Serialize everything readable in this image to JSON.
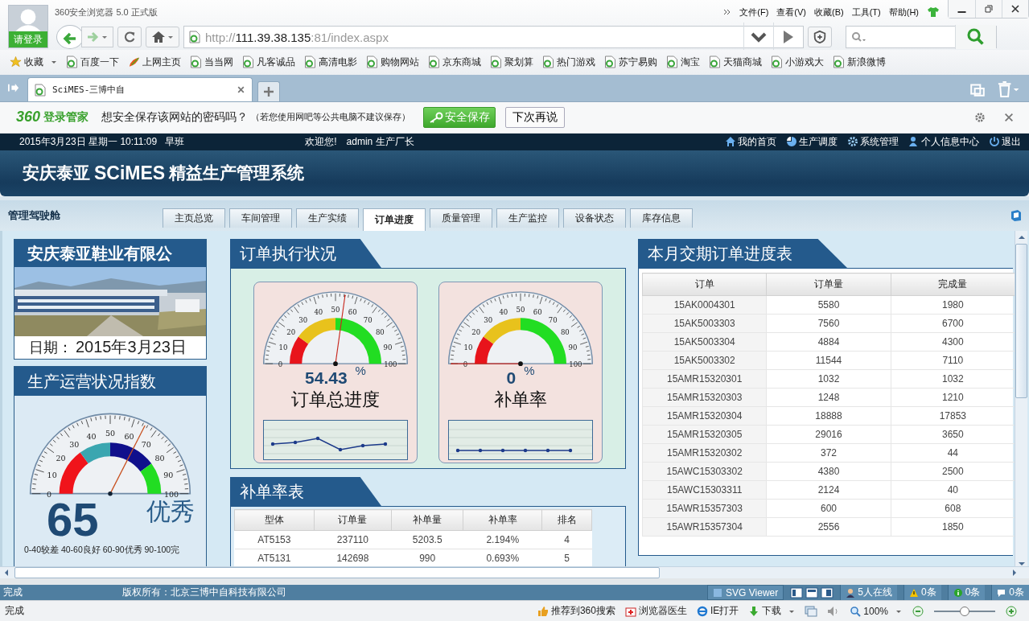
{
  "browser": {
    "title": "360安全浏览器 5.0 正式版",
    "login": "请登录",
    "menu": [
      "文件(F)",
      "查看(V)",
      "收藏(B)",
      "工具(T)",
      "帮助(H)"
    ],
    "address": {
      "scheme": "http://",
      "host": "111.39.38.135",
      "rest": ":81/index.aspx"
    },
    "bookmarks": [
      {
        "label": "收藏",
        "kind": "favorites"
      },
      {
        "label": "百度一下",
        "kind": "page"
      },
      {
        "label": "上网主页",
        "kind": "hao"
      },
      {
        "label": "当当网",
        "kind": "page"
      },
      {
        "label": "凡客诚品",
        "kind": "page"
      },
      {
        "label": "高清电影",
        "kind": "page"
      },
      {
        "label": "购物网站",
        "kind": "page"
      },
      {
        "label": "京东商城",
        "kind": "page"
      },
      {
        "label": "聚划算",
        "kind": "page"
      },
      {
        "label": "热门游戏",
        "kind": "page"
      },
      {
        "label": "苏宁易购",
        "kind": "page"
      },
      {
        "label": "淘宝",
        "kind": "page"
      },
      {
        "label": "天猫商城",
        "kind": "page"
      },
      {
        "label": "小游戏大",
        "kind": "page"
      },
      {
        "label": "新浪微博",
        "kind": "page"
      }
    ],
    "tabs": [
      {
        "label": "SciMES-三博中自",
        "selected": true
      }
    ],
    "password_bar": {
      "brand": "360",
      "product": "登录管家",
      "question": "想安全保存该网站的密码吗？",
      "note": "（若您使用网吧等公共电脑不建议保存）",
      "save": "安全保存",
      "later": "下次再说"
    }
  },
  "top_bar": {
    "datetime": "2015年3月23日  星期一  10:11:09",
    "shift": "早班",
    "welcome": "欢迎您!",
    "user": "admin 生产厂长",
    "links": [
      {
        "label": "我的首页",
        "kind": "home"
      },
      {
        "label": "生产调度",
        "kind": "dispatch"
      },
      {
        "label": "系统管理",
        "kind": "settings"
      },
      {
        "label": "个人信息中心",
        "kind": "user"
      },
      {
        "label": "退出",
        "kind": "logout"
      }
    ]
  },
  "header": {
    "company": "安庆泰亚",
    "brand": "SCiMES",
    "system": "精益生产管理系统"
  },
  "nav": {
    "title": "管理驾驶舱",
    "tabs": [
      {
        "label": "主页总览",
        "selected": false
      },
      {
        "label": "车间管理",
        "selected": false
      },
      {
        "label": "生产实绩",
        "selected": false
      },
      {
        "label": "订单进度",
        "selected": true
      },
      {
        "label": "质量管理",
        "selected": false
      },
      {
        "label": "生产监控",
        "selected": false
      },
      {
        "label": "设备状态",
        "selected": false
      },
      {
        "label": "库存信息",
        "selected": false
      }
    ]
  },
  "company_panel": {
    "title": "安庆泰亚鞋业有限公",
    "date_label": "日期：",
    "date": "2015年3月23日"
  },
  "index_panel": {
    "title": "生产运营状况指数",
    "gauge": {
      "kind": "index",
      "level": 0.65,
      "ticks": [
        "0",
        "10",
        "20",
        "30",
        "40",
        "50",
        "60",
        "70",
        "80",
        "90",
        "100"
      ]
    },
    "value": "65",
    "rating": "优秀",
    "legend": "0-40较差  40-60良好  60-90优秀  90-100完"
  },
  "order_panel": {
    "title": "订单执行状况",
    "gauges": [
      {
        "kind": "progress",
        "level": 0.5443,
        "ticks": [
          "0",
          "10",
          "20",
          "30",
          "40",
          "50",
          "60",
          "70",
          "80",
          "90",
          "100"
        ],
        "value": "54.43",
        "unit": "%",
        "label": "订单总进度"
      },
      {
        "kind": "progress",
        "level": 0,
        "ticks": [
          "0",
          "10",
          "20",
          "30",
          "40",
          "50",
          "60",
          "70",
          "80",
          "90",
          "100"
        ],
        "value": "0",
        "unit": "%",
        "label": "补单率"
      }
    ]
  },
  "rework_table": {
    "title": "补单率表",
    "columns": [
      "型体",
      "订单量",
      "补单量",
      "补单率",
      "排名"
    ],
    "rows": [
      [
        "AT5153",
        "237110",
        "5203.5",
        "2.194%",
        "4"
      ],
      [
        "AT5131",
        "142698",
        "990",
        "0.693%",
        "5"
      ]
    ]
  },
  "order_table": {
    "title": "本月交期订单进度表",
    "columns": [
      "订单",
      "订单量",
      "完成量"
    ],
    "rows": [
      [
        "15AK0004301",
        "5580",
        "1980"
      ],
      [
        "15AK5003303",
        "7560",
        "6700"
      ],
      [
        "15AK5003304",
        "4884",
        "4300"
      ],
      [
        "15AK5003302",
        "11544",
        "7110"
      ],
      [
        "15AMR15320301",
        "1032",
        "1032"
      ],
      [
        "15AMR15320303",
        "1248",
        "1210"
      ],
      [
        "15AMR15320304",
        "18888",
        "17853"
      ],
      [
        "15AMR15320305",
        "29016",
        "3650"
      ],
      [
        "15AMR15320302",
        "372",
        "44"
      ],
      [
        "15AWC15303302",
        "4380",
        "2500"
      ],
      [
        "15AWC15303311",
        "2124",
        "40"
      ],
      [
        "15AWR15357303",
        "600",
        "608"
      ],
      [
        "15AWR15357304",
        "2556",
        "1850"
      ]
    ]
  },
  "page_status": {
    "status": "完成",
    "copyright": "版权所有：北京三博中自科技有限公司",
    "viewer": "SVG Viewer",
    "online": "5人在线",
    "warnings": "0条",
    "info": "0条",
    "messages": "0条"
  },
  "status_bar": {
    "status": "完成",
    "items": [
      {
        "label": "推荐到360搜索",
        "kind": "recommend"
      },
      {
        "label": "浏览器医生",
        "kind": "doctor"
      },
      {
        "label": "IE打开",
        "kind": "ie"
      },
      {
        "label": "下载",
        "kind": "download"
      }
    ],
    "zoom": "100%",
    "zoom_slider": {
      "level": 0.5
    }
  }
}
